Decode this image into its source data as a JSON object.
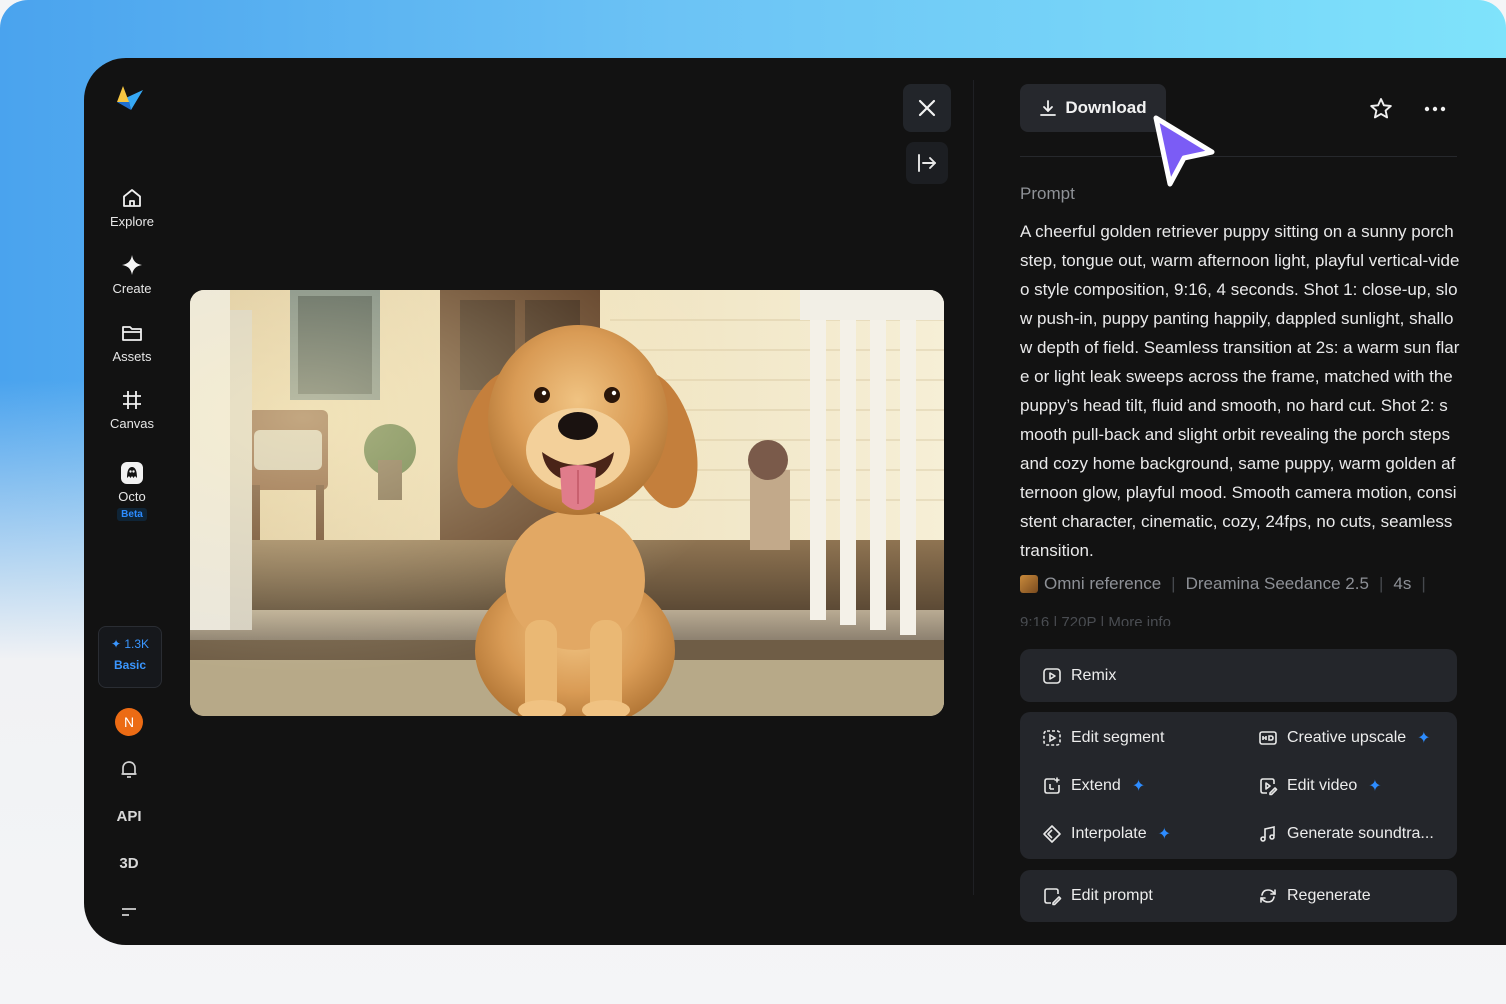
{
  "sidebar": {
    "items": [
      {
        "label": "Explore",
        "icon": "home-icon"
      },
      {
        "label": "Create",
        "icon": "sparkle-icon"
      },
      {
        "label": "Assets",
        "icon": "folder-icon"
      },
      {
        "label": "Canvas",
        "icon": "canvas-icon"
      },
      {
        "label": "Octo",
        "icon": "octo-icon",
        "badge": "Beta"
      }
    ],
    "credits": {
      "amount": "1.3K",
      "plan": "Basic"
    },
    "avatar_initial": "N",
    "api_label": "API",
    "three_d_label": "3D"
  },
  "toolbar": {
    "download_label": "Download"
  },
  "prompt": {
    "label": "Prompt",
    "text": "A cheerful golden retriever puppy sitting on a sunny porch step, tongue out, warm afternoon light, playful vertical-video style composition, 9:16, 4 seconds. Shot 1: close-up, slow push-in, puppy panting happily, dappled sunlight, shallow depth of field. Seamless transition at 2s: a warm sun flare or light leak sweeps across the frame, matched with the puppy’s head tilt, fluid and smooth, no hard cut. Shot 2: smooth pull-back and slight orbit revealing the porch steps and cozy home background, same puppy, warm golden afternoon glow, playful mood. Smooth camera motion, consistent character, cinematic, cozy, 24fps, no cuts, seamless transition."
  },
  "meta": {
    "reference": "Omni reference",
    "model": "Dreamina Seedance 2.5",
    "duration": "4s",
    "row2": "9:16 | 720P | More info"
  },
  "actions": {
    "remix": "Remix",
    "edit_segment": "Edit segment",
    "creative_upscale": "Creative upscale",
    "extend": "Extend",
    "edit_video": "Edit video",
    "interpolate": "Interpolate",
    "generate_soundtrack": "Generate soundtra...",
    "edit_prompt": "Edit prompt",
    "regenerate": "Regenerate",
    "spark_glyph": "✦"
  },
  "colors": {
    "accent": "#2d8cff",
    "panel": "#121212",
    "card": "#24262b",
    "cursor": "#7b5cf5",
    "avatar": "#ec6b14"
  }
}
